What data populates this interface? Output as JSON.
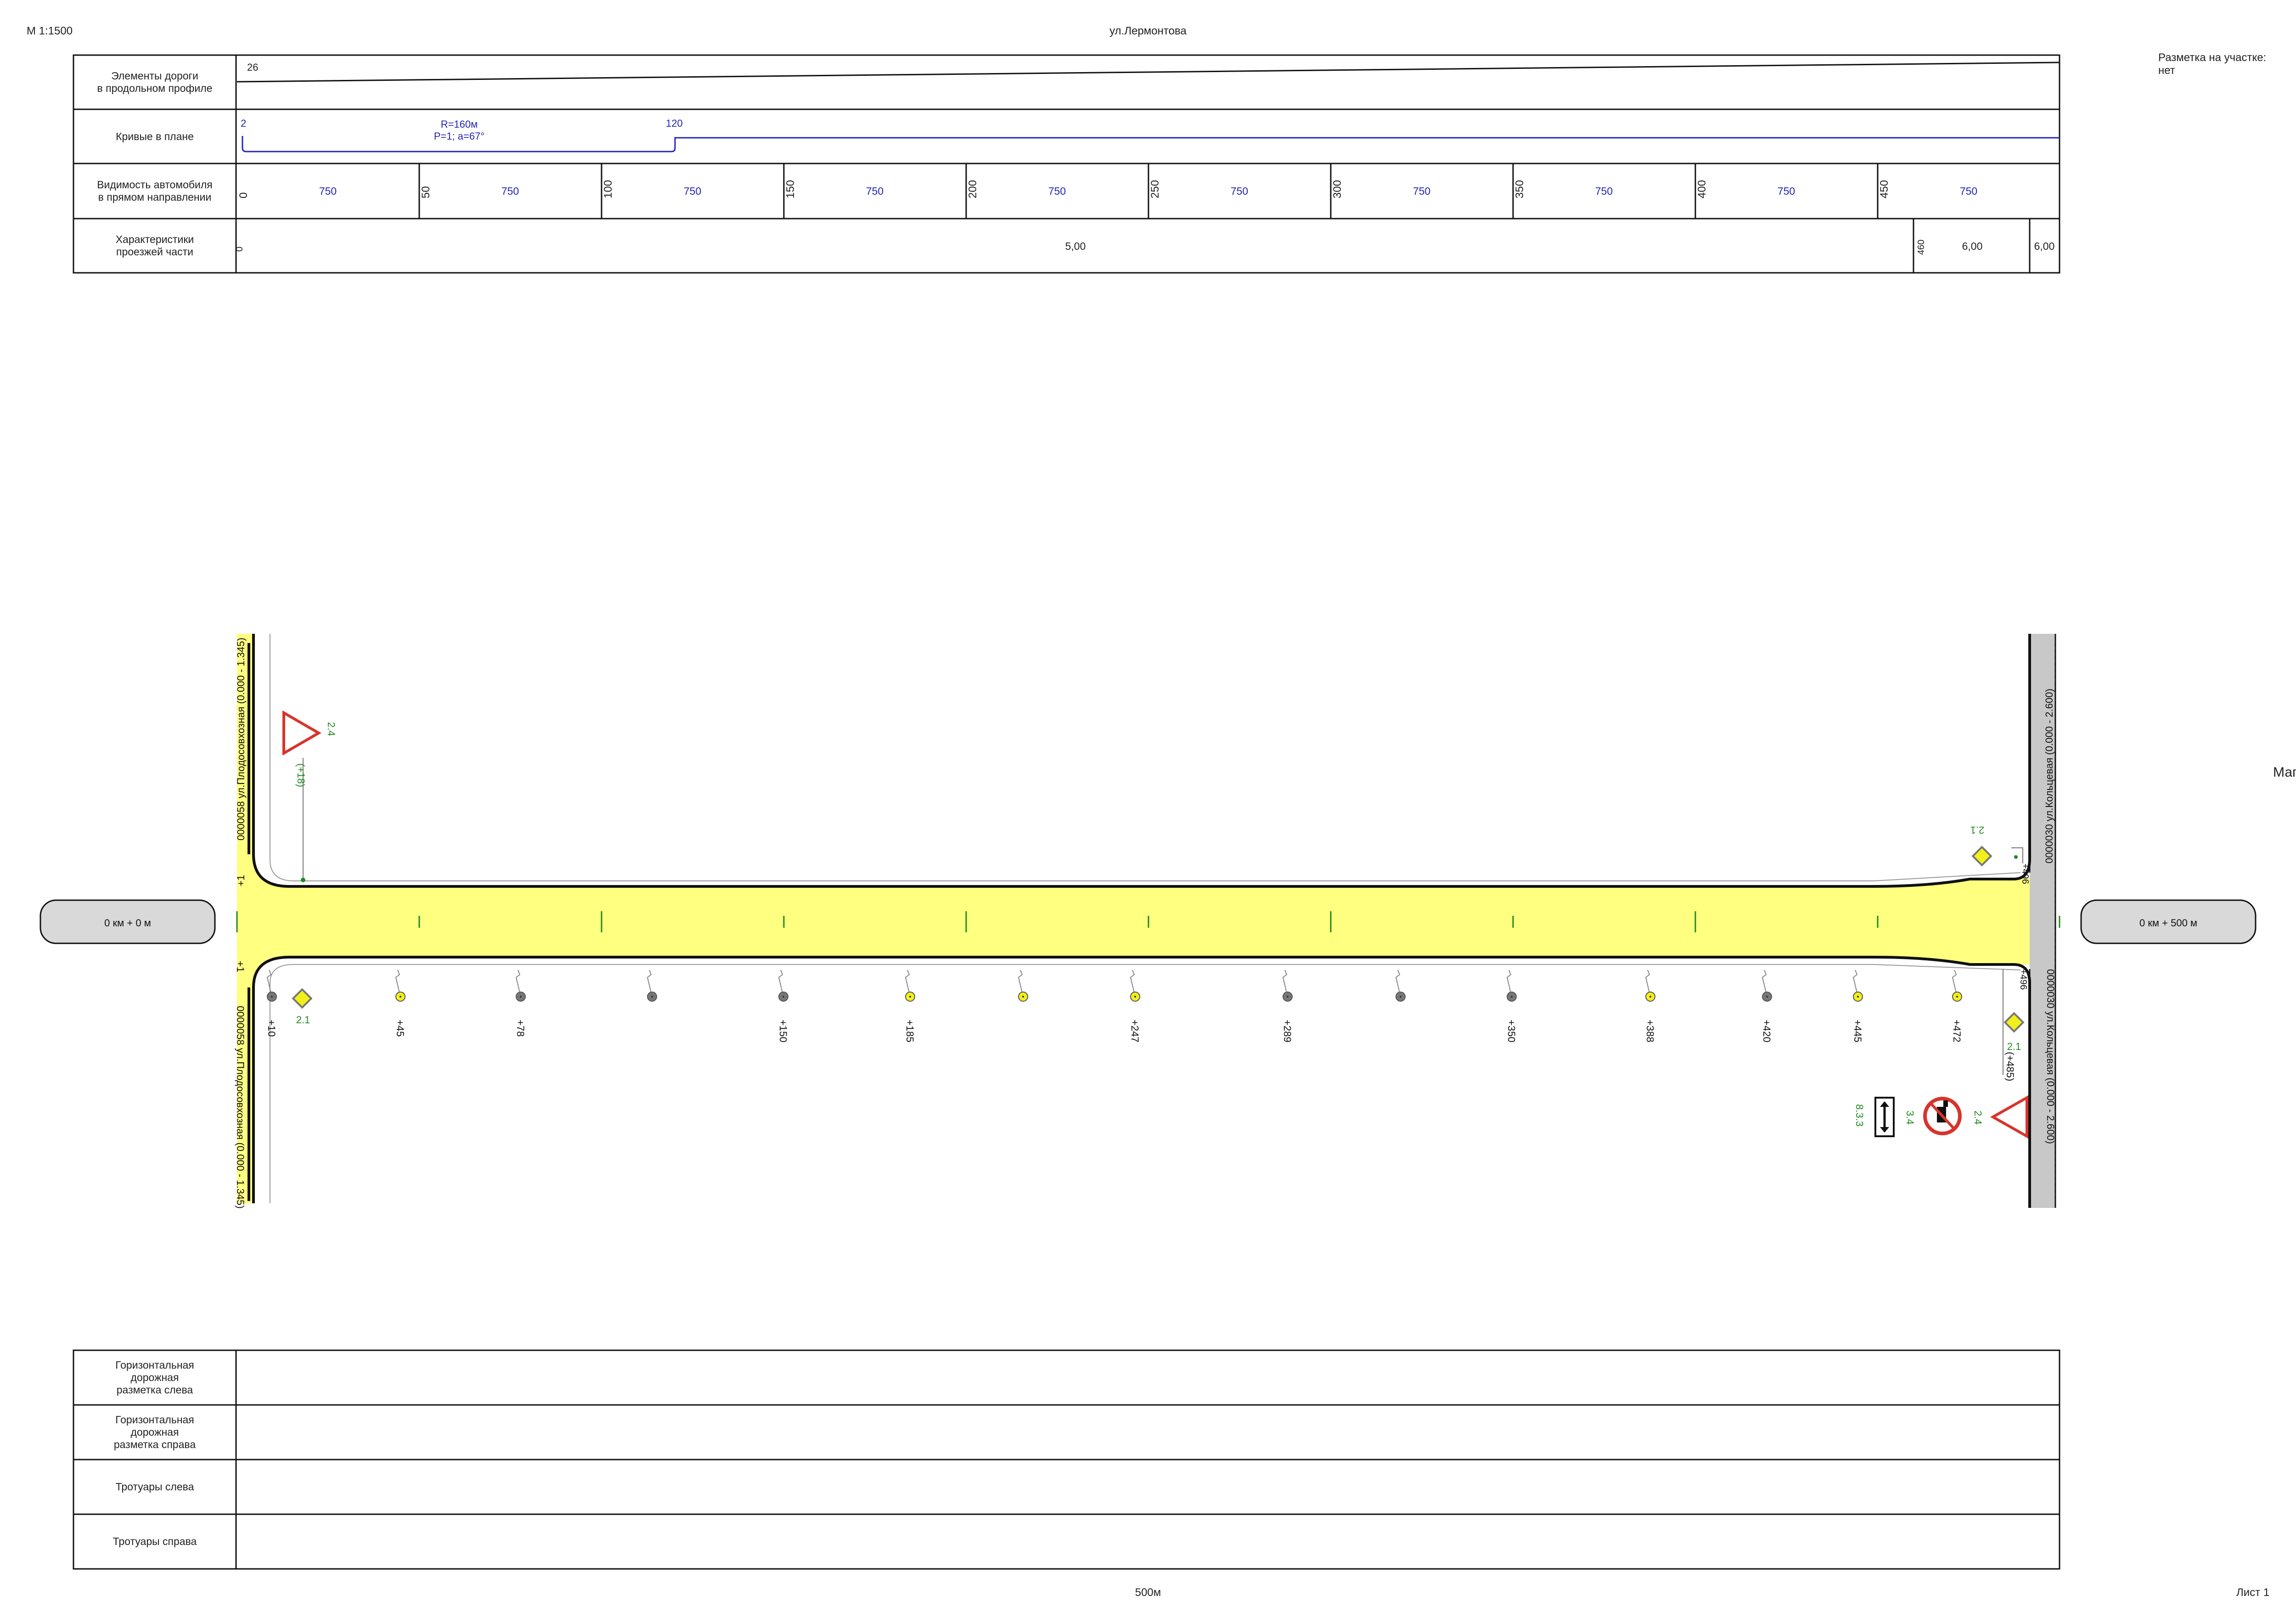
{
  "header": {
    "scale": "М 1:1500",
    "street": "ул.Лермонтова",
    "marking_info": "Разметка на участке:",
    "marking_value": "нет",
    "cut_text": "Маг",
    "footer_length": "500м",
    "sheet": "Лист 1"
  },
  "top_table": {
    "rows": [
      {
        "label": "Элементы дороги\nв продольном профиле"
      },
      {
        "label": "Кривые в плане"
      },
      {
        "label": "Видимость автомобиля\nв прямом направлении"
      },
      {
        "label": "Характеристики\nпроезжей части"
      }
    ],
    "profile_value": "26",
    "curve": {
      "start": "2",
      "end": "120",
      "radius": "R=160м",
      "params": "P=1; a=67°"
    },
    "visibility": [
      {
        "km": "0",
        "value": "750"
      },
      {
        "km": "50",
        "value": "750"
      },
      {
        "km": "100",
        "value": "750"
      },
      {
        "km": "150",
        "value": "750"
      },
      {
        "km": "200",
        "value": "750"
      },
      {
        "km": "250",
        "value": "750"
      },
      {
        "km": "300",
        "value": "750"
      },
      {
        "km": "350",
        "value": "750"
      },
      {
        "km": "400",
        "value": "750"
      },
      {
        "km": "450",
        "value": "750"
      }
    ],
    "carriageway": {
      "start": "0",
      "width_1": "5,00",
      "break": "460",
      "width_2": "6,00",
      "width_3": "6,00"
    }
  },
  "plan": {
    "start_label": "0 км + 0 м",
    "end_label": "0 км + 500 м",
    "left_street_top": "0000058 ул.Плодосовхозная (0.000 - 1.345)",
    "left_street_bottom": "0000058 ул.Плодосовхозная (0.000 - 1.345)",
    "right_street_top": "0000030 ул.Кольцевая (0.000 - 2.600)",
    "right_street_bottom": "0000030 ул.Кольцевая (0.000 - 2.600)",
    "left_plus_top": "+1",
    "left_plus_bottom": "+1",
    "right_plus_top": "+496",
    "right_plus_bottom": "+496",
    "sign_top_left": {
      "code": "2.4",
      "offset": "(+18)"
    },
    "sign_bottom_left": {
      "code": "2.1"
    },
    "sign_top_right": {
      "code": "2.1"
    },
    "sign_bottom_right_main": {
      "code": "2.1",
      "offset": "(+485)"
    },
    "sign_yield_right": {
      "code": "2.4"
    },
    "sign_no_parking": {
      "code": "3.4"
    },
    "sign_plate": {
      "code": "8.3.3"
    },
    "lamps": [
      {
        "label": "+10",
        "color": "#777777"
      },
      {
        "label": "+45",
        "color": "#f2ef1a"
      },
      {
        "label": "+78",
        "color": "#777777"
      },
      {
        "label": "",
        "color": "#777777"
      },
      {
        "label": "+150",
        "color": "#777777"
      },
      {
        "label": "+185",
        "color": "#f2ef1a"
      },
      {
        "label": "",
        "color": "#f2ef1a"
      },
      {
        "label": "+247",
        "color": "#f2ef1a"
      },
      {
        "label": "+289",
        "color": "#777777"
      },
      {
        "label": "",
        "color": "#777777"
      },
      {
        "label": "+350",
        "color": "#777777"
      },
      {
        "label": "+388",
        "color": "#f2ef1a"
      },
      {
        "label": "+420",
        "color": "#777777"
      },
      {
        "label": "+445",
        "color": "#f2ef1a"
      },
      {
        "label": "+472",
        "color": "#f2ef1a"
      }
    ]
  },
  "bottom_table": {
    "rows": [
      {
        "label": "Горизонтальная\nдорожная\nразметка слева"
      },
      {
        "label": "Горизонтальная\nдорожная\nразметка справа"
      },
      {
        "label": "Тротуары слева"
      },
      {
        "label": "Тротуары справа"
      }
    ]
  },
  "colors": {
    "road": "#ffff80",
    "blue": "#2424b8",
    "green": "#1f8a1f",
    "red": "#d8342c",
    "grey_road": "#c8c8c8"
  }
}
